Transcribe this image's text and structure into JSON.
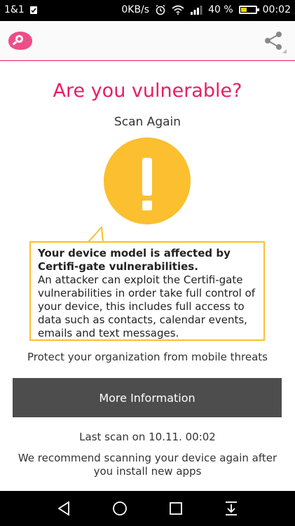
{
  "status_bar": {
    "carrier": "1&1",
    "speed": "0KB/s",
    "battery_percent": "40 %",
    "battery_level": 0.4,
    "time": "00:02"
  },
  "app_bar": {
    "logo_icon": "zimperium-logo-icon",
    "share_icon": "share-icon"
  },
  "main": {
    "title": "Are you vulnerable?",
    "scan_again": "Scan Again",
    "warning_icon": "exclamation-icon",
    "bubble": {
      "heading": "Your device model is affected by Certifi-gate vulnerabilities.",
      "body": "An attacker can exploit the Certifi-gate vulnerabilities in order take full control of your device, this includes full access to data such as contacts, calendar events, emails and text messages."
    },
    "protect_text": "Protect your organization from mobile threats",
    "more_info_label": "More Information",
    "last_scan": "Last scan on 10.11. 00:02",
    "recommend": "We recommend scanning your device again after you install new apps"
  },
  "nav_bar": {
    "back_icon": "back-triangle-icon",
    "home_icon": "home-circle-icon",
    "recents_icon": "recents-square-icon",
    "notifications_icon": "pull-down-icon"
  },
  "colors": {
    "accent": "#e91e63",
    "warning": "#fbbf2f",
    "button": "#4d4d4d"
  }
}
